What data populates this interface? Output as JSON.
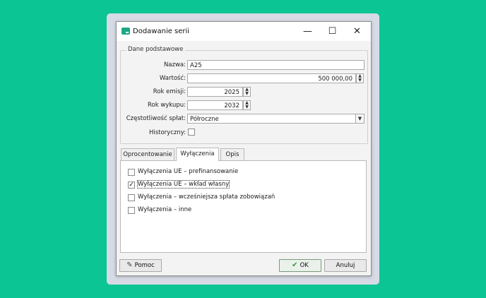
{
  "window": {
    "title": "Dodawanie serii",
    "minimize_glyph": "—",
    "maximize_glyph": "☐",
    "close_glyph": "✕"
  },
  "basic": {
    "group_title": "Dane podstawowe",
    "name_label": "Nazwa:",
    "name_value": "A25",
    "value_label": "Wartość:",
    "value_value": "500 000,00",
    "issue_year_label": "Rok emisji:",
    "issue_year_value": "2025",
    "buyout_year_label": "Rok wykupu:",
    "buyout_year_value": "2032",
    "frequency_label": "Częstotliwość spłat:",
    "frequency_value": "Półroczne",
    "historical_label": "Historyczny:",
    "historical_checked": false
  },
  "tabs": [
    {
      "label": "Oprocentowanie",
      "active": false
    },
    {
      "label": "Wyłączenia",
      "active": true
    },
    {
      "label": "Opis",
      "active": false
    }
  ],
  "exclusions": [
    {
      "label": "Wyłączenia UE – prefinansowanie",
      "checked": false,
      "check_glyph": ""
    },
    {
      "label": "Wyłączenia UE – wkład własny",
      "checked": true,
      "check_glyph": "✓"
    },
    {
      "label": "Wyłączenia – wcześniejsza spłata zobowiązań",
      "checked": false,
      "check_glyph": ""
    },
    {
      "label": "Wyłączenia – inne",
      "checked": false,
      "check_glyph": ""
    }
  ],
  "footer": {
    "help_label": "Pomoc",
    "ok_label": "OK",
    "cancel_label": "Anuluj"
  },
  "icons": {
    "spin_up": "▲",
    "spin_down": "▼",
    "dropdown": "▼",
    "ok": "✔",
    "help": "✎"
  },
  "colors": {
    "background": "#0cc595",
    "frame": "#d6dbe6",
    "accent_icon": "#1ea884"
  }
}
